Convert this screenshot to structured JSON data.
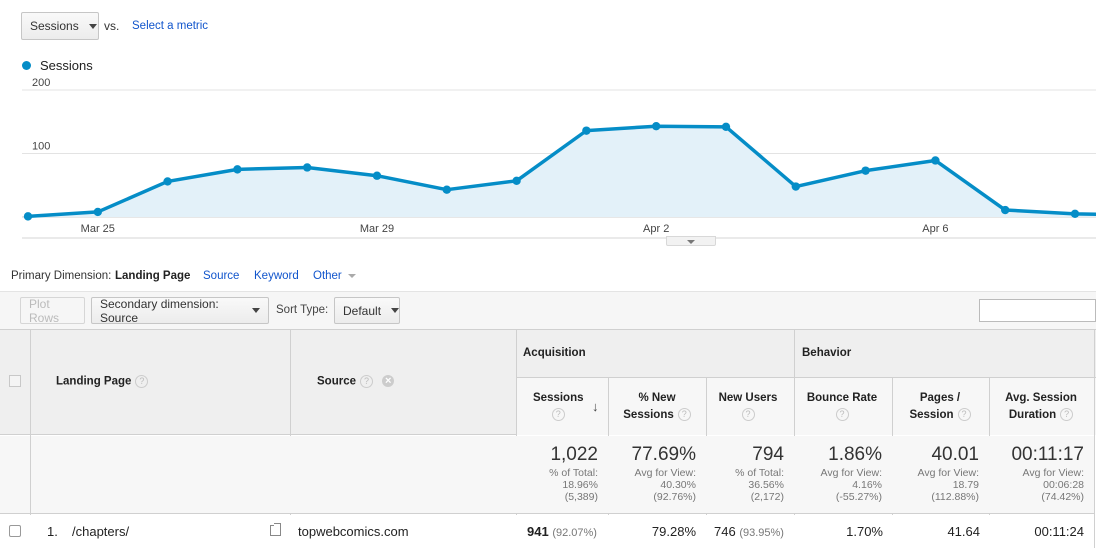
{
  "metric_bar": {
    "metric_select": "Sessions",
    "vs_label": "vs.",
    "select_metric_link": "Select a metric"
  },
  "chart_data": {
    "type": "area",
    "legend": [
      {
        "name": "Sessions",
        "color": "#058dc7"
      }
    ],
    "y_ticks": [
      "200",
      "100"
    ],
    "ylim": [
      0,
      200
    ],
    "x_tick_labels": [
      "Mar 25",
      "Mar 29",
      "Apr 2",
      "Apr 6"
    ],
    "x": [
      "Mar 24",
      "Mar 25",
      "Mar 26",
      "Mar 27",
      "Mar 28",
      "Mar 29",
      "Mar 30",
      "Mar 31",
      "Apr 1",
      "Apr 2",
      "Apr 3",
      "Apr 4",
      "Apr 5",
      "Apr 6",
      "Apr 7",
      "Apr 8",
      "Apr 9"
    ],
    "series": [
      {
        "name": "Sessions",
        "color": "#058dc7",
        "values": [
          1,
          8,
          56,
          75,
          78,
          65,
          43,
          57,
          136,
          143,
          142,
          48,
          73,
          89,
          11,
          5,
          3
        ]
      }
    ],
    "grid": true
  },
  "dimension_bar": {
    "label": "Primary Dimension:",
    "active": "Landing Page",
    "options": [
      "Source",
      "Keyword",
      "Other"
    ]
  },
  "toolbar": {
    "plot_rows": "Plot Rows",
    "secondary_dimension": "Secondary dimension: Source",
    "sort_type_label": "Sort Type:",
    "sort_type": "Default",
    "search_placeholder": ""
  },
  "table": {
    "group_acquisition": "Acquisition",
    "group_behavior": "Behavior",
    "col_landing_page": "Landing Page",
    "col_source": "Source",
    "columns": [
      {
        "line1": "Sessions",
        "line2": ""
      },
      {
        "line1": "% New",
        "line2": "Sessions"
      },
      {
        "line1": "New Users",
        "line2": ""
      },
      {
        "line1": "Bounce Rate",
        "line2": ""
      },
      {
        "line1": "Pages /",
        "line2": "Session"
      },
      {
        "line1": "Avg. Session",
        "line2": "Duration"
      }
    ],
    "help_glyph": "?",
    "remove_glyph": "×",
    "totals": [
      {
        "value": "1,022",
        "l1": "% of Total:",
        "l2": "18.96%",
        "l3": "(5,389)"
      },
      {
        "value": "77.69%",
        "l1": "Avg for View:",
        "l2": "40.30%",
        "l3": "(92.76%)"
      },
      {
        "value": "794",
        "l1": "% of Total:",
        "l2": "36.56%",
        "l3": "(2,172)"
      },
      {
        "value": "1.86%",
        "l1": "Avg for View:",
        "l2": "4.16%",
        "l3": "(-55.27%)"
      },
      {
        "value": "40.01",
        "l1": "Avg for View:",
        "l2": "18.79",
        "l3": "(112.88%)"
      },
      {
        "value": "00:11:17",
        "l1": "Avg for View:",
        "l2": "00:06:28",
        "l3": "(74.42%)"
      }
    ],
    "rows": [
      {
        "index": "1.",
        "landing_page": "/chapters/",
        "source": "topwebcomics.com",
        "sessions": "941",
        "sessions_pct": "(92.07%)",
        "pct_new": "79.28%",
        "new_users": "746",
        "new_users_pct": "(93.95%)",
        "bounce": "1.70%",
        "pages": "41.64",
        "duration": "00:11:24"
      }
    ]
  }
}
